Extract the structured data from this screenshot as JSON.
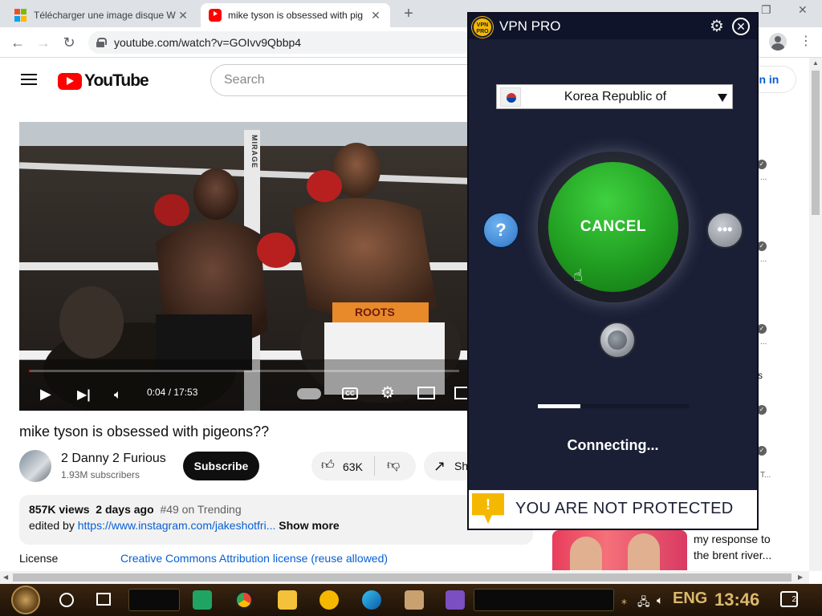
{
  "browser": {
    "tabs": [
      {
        "title": "Télécharger une image disque W",
        "icon": "microsoft-icon"
      },
      {
        "title": "mike tyson is obsessed with pig",
        "icon": "youtube-icon"
      }
    ],
    "url": "youtube.com/watch?v=GOIvv9Qbbp4"
  },
  "youtube": {
    "logo_text": "YouTube",
    "search_placeholder": "Search",
    "signin_label": "ign in"
  },
  "player": {
    "current_time": "0:04",
    "duration": "17:53",
    "time_display": "0:04 / 17:53",
    "progress_fraction": 0.004,
    "ring_text": "MIRAGE",
    "trunks_text": "ROOTS"
  },
  "video": {
    "title": "mike tyson is obsessed with pigeons??",
    "channel": "2 Danny 2 Furious",
    "subscribers": "1.93M subscribers",
    "subscribe_label": "Subscribe",
    "likes": "63K",
    "share_label": "Sh",
    "views": "857K views",
    "age": "2 days ago",
    "trending": "#49 on Trending",
    "description_prefix": "edited by ",
    "description_link": "https://www.instagram.com/jakeshotfri...",
    "show_more": "Show more",
    "license_label": "License",
    "license_value": "Creative Commons Attribution license (reuse allowed)"
  },
  "sidebar": {
    "recommended_title_line1": "my response to",
    "recommended_title_line2": "the brent river...",
    "snippets": [
      "...",
      "...",
      "...",
      "s",
      "T..."
    ]
  },
  "vpn": {
    "app_name": "VPN PRO",
    "logo_text": "VPN PRO",
    "country": "Korea Republic of",
    "main_button": "CANCEL",
    "help_label": "?",
    "more_label": "•••",
    "status": "Connecting...",
    "progress_fraction": 0.28,
    "warning_icon_text": "!",
    "warning": "YOU ARE NOT PROTECTED",
    "accent_green": "#2bb52b",
    "warning_yellow": "#f5b800"
  },
  "taskbar": {
    "language": "ENG",
    "time": "13:46",
    "notification_count": "2"
  }
}
